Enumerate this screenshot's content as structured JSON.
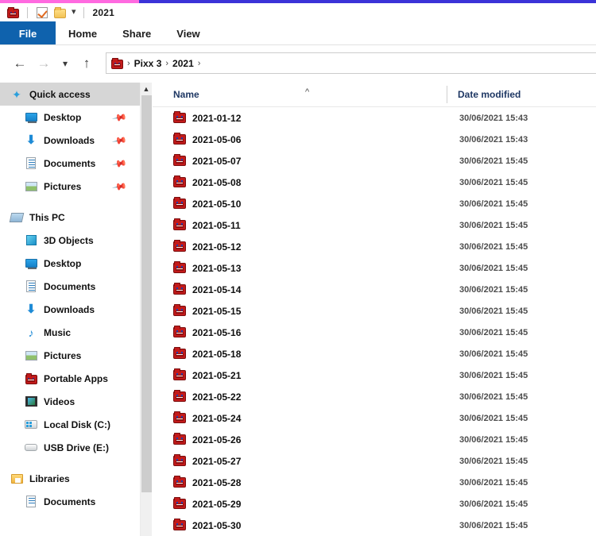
{
  "accent": {
    "left_color": "#ff6ae0",
    "right_color": "#3b33d8"
  },
  "titlebar": {
    "app_icon": "red-face-folder-icon",
    "checkbox_icon": "checkbox-checked-icon",
    "new_folder_icon": "new-folder-icon",
    "customize_icon": "customize-quick-access-caret-icon",
    "title": "2021"
  },
  "ribbon": {
    "file_label": "File",
    "tabs": [
      {
        "label": "Home"
      },
      {
        "label": "Share"
      },
      {
        "label": "View"
      }
    ]
  },
  "nav": {
    "back_icon": "back-arrow-icon",
    "forward_icon": "forward-arrow-icon",
    "recent_icon": "recent-locations-chevron-icon",
    "up_icon": "up-arrow-icon",
    "address_icon": "red-face-folder-icon",
    "breadcrumbs": [
      {
        "label": "Pixx 3"
      },
      {
        "label": "2021"
      }
    ],
    "separator": "›"
  },
  "sidebar": {
    "scroll_up_icon": "scroll-up-chevron-icon",
    "groups": [
      {
        "header": {
          "label": "Quick access",
          "icon": "quick-access-star-icon",
          "selected": true
        },
        "items": [
          {
            "label": "Desktop",
            "icon": "desktop-monitor-icon",
            "pinned": true
          },
          {
            "label": "Downloads",
            "icon": "downloads-arrow-icon",
            "pinned": true
          },
          {
            "label": "Documents",
            "icon": "documents-icon",
            "pinned": true
          },
          {
            "label": "Pictures",
            "icon": "pictures-icon",
            "pinned": true
          }
        ]
      },
      {
        "header": {
          "label": "This PC",
          "icon": "this-pc-icon",
          "selected": false
        },
        "items": [
          {
            "label": "3D Objects",
            "icon": "3d-objects-cube-icon",
            "pinned": false
          },
          {
            "label": "Desktop",
            "icon": "desktop-monitor-icon",
            "pinned": false
          },
          {
            "label": "Documents",
            "icon": "documents-icon",
            "pinned": false
          },
          {
            "label": "Downloads",
            "icon": "downloads-arrow-icon",
            "pinned": false
          },
          {
            "label": "Music",
            "icon": "music-note-icon",
            "pinned": false
          },
          {
            "label": "Pictures",
            "icon": "pictures-icon",
            "pinned": false
          },
          {
            "label": "Portable Apps",
            "icon": "red-face-folder-icon",
            "pinned": false
          },
          {
            "label": "Videos",
            "icon": "videos-film-icon",
            "pinned": false
          },
          {
            "label": "Local Disk (C:)",
            "icon": "local-disk-icon",
            "pinned": false
          },
          {
            "label": "USB Drive (E:)",
            "icon": "usb-drive-icon",
            "pinned": false
          }
        ]
      },
      {
        "header": {
          "label": "Libraries",
          "icon": "libraries-folder-icon",
          "selected": false
        },
        "items": [
          {
            "label": "Documents",
            "icon": "library-documents-icon",
            "pinned": false
          }
        ]
      }
    ]
  },
  "filepane": {
    "columns": {
      "name": "Name",
      "date_modified": "Date modified",
      "sort_icon": "sort-ascending-chevron-icon"
    },
    "rows": [
      {
        "name": "2021-01-12",
        "date": "30/06/2021 15:43",
        "icon": "red-face-folder-icon"
      },
      {
        "name": "2021-05-06",
        "date": "30/06/2021 15:43",
        "icon": "red-face-folder-icon"
      },
      {
        "name": "2021-05-07",
        "date": "30/06/2021 15:45",
        "icon": "red-face-folder-icon"
      },
      {
        "name": "2021-05-08",
        "date": "30/06/2021 15:45",
        "icon": "red-face-folder-icon"
      },
      {
        "name": "2021-05-10",
        "date": "30/06/2021 15:45",
        "icon": "red-face-folder-icon"
      },
      {
        "name": "2021-05-11",
        "date": "30/06/2021 15:45",
        "icon": "red-face-folder-icon"
      },
      {
        "name": "2021-05-12",
        "date": "30/06/2021 15:45",
        "icon": "red-face-folder-icon"
      },
      {
        "name": "2021-05-13",
        "date": "30/06/2021 15:45",
        "icon": "red-face-folder-icon"
      },
      {
        "name": "2021-05-14",
        "date": "30/06/2021 15:45",
        "icon": "red-face-folder-icon"
      },
      {
        "name": "2021-05-15",
        "date": "30/06/2021 15:45",
        "icon": "red-face-folder-icon"
      },
      {
        "name": "2021-05-16",
        "date": "30/06/2021 15:45",
        "icon": "red-face-folder-icon"
      },
      {
        "name": "2021-05-18",
        "date": "30/06/2021 15:45",
        "icon": "red-face-folder-icon"
      },
      {
        "name": "2021-05-21",
        "date": "30/06/2021 15:45",
        "icon": "red-face-folder-icon"
      },
      {
        "name": "2021-05-22",
        "date": "30/06/2021 15:45",
        "icon": "red-face-folder-icon"
      },
      {
        "name": "2021-05-24",
        "date": "30/06/2021 15:45",
        "icon": "red-face-folder-icon"
      },
      {
        "name": "2021-05-26",
        "date": "30/06/2021 15:45",
        "icon": "red-face-folder-icon"
      },
      {
        "name": "2021-05-27",
        "date": "30/06/2021 15:45",
        "icon": "red-face-folder-icon"
      },
      {
        "name": "2021-05-28",
        "date": "30/06/2021 15:45",
        "icon": "red-face-folder-icon"
      },
      {
        "name": "2021-05-29",
        "date": "30/06/2021 15:45",
        "icon": "red-face-folder-icon"
      },
      {
        "name": "2021-05-30",
        "date": "30/06/2021 15:45",
        "icon": "red-face-folder-icon"
      }
    ]
  }
}
